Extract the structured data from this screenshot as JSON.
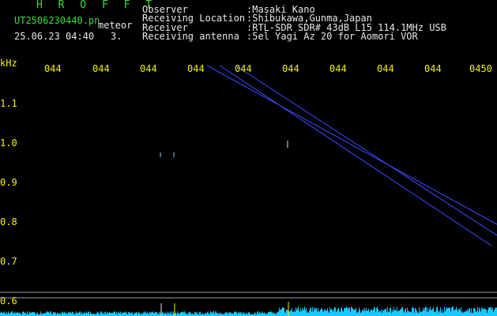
{
  "header": {
    "app_name": "H R O F F T",
    "filename": "UT2506230440.pn",
    "mode": "meteor",
    "datetime": "25.06.23 04:40",
    "count": "3.",
    "fields": [
      {
        "label": "Observer",
        "value": ":Masaki Kano"
      },
      {
        "label": "Receiving Location",
        "value": ":Shibukawa,Gunma,Japan"
      },
      {
        "label": "Receiver",
        "value": ":RTL-SDR SDR# 43dB L15 114.1MHz USB"
      },
      {
        "label": "Receiving antenna",
        "value": ":5el Yagi Az 20 for Aomori VOR"
      }
    ]
  },
  "time_axis": {
    "ticks": [
      "044",
      "044",
      "044",
      "044",
      "044",
      "044",
      "044",
      "044",
      "044",
      "0450"
    ]
  },
  "freq_axis": {
    "unit": "kHz",
    "ticks": [
      "1.1",
      "1.0",
      "0.9",
      "0.8",
      "0.7",
      "0.6"
    ]
  },
  "colors": {
    "header_green": "#3ddc3d",
    "text_white": "#e8e8e8",
    "axis_yellow": "#f2f000",
    "trace_blue": "#3a4dff",
    "spectrum_cyan": "#19c8ff"
  }
}
